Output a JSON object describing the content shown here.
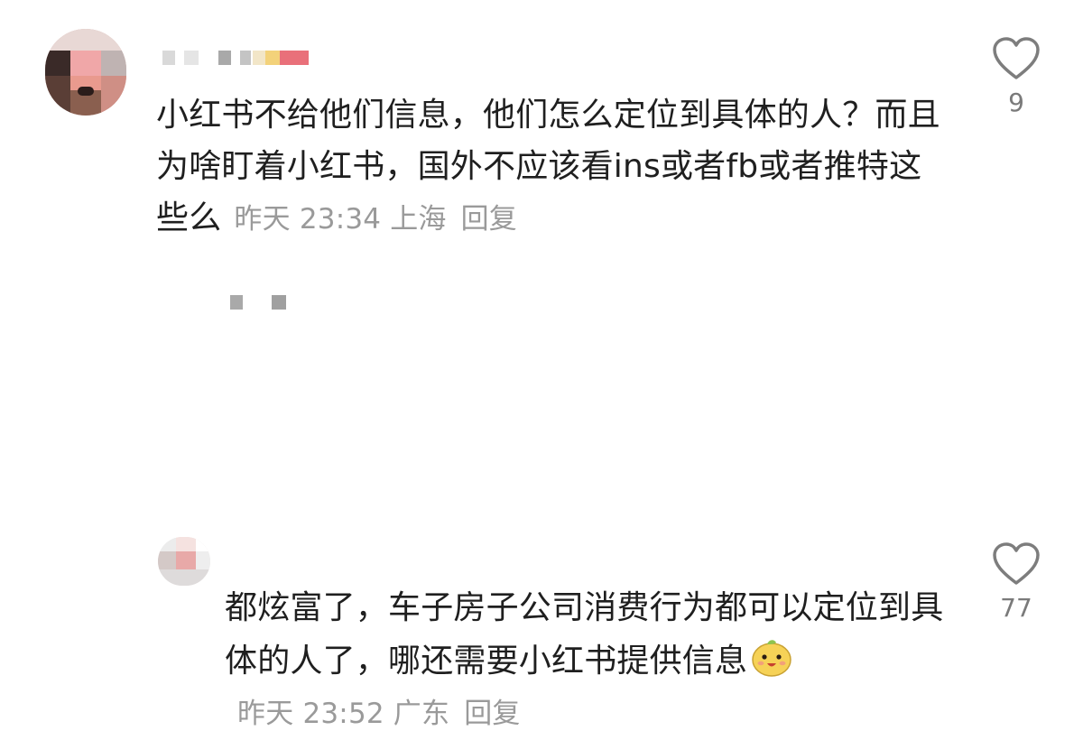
{
  "comments": [
    {
      "text": "小红书不给他们信息，他们怎么定位到具体的人？而且为啥盯着小红书，国外不应该看ins或者fb或者推特这些么",
      "time": "昨天 23:34",
      "location": "上海",
      "reply_label": "回复",
      "likes": "9"
    },
    {
      "text": "都炫富了，车子房子公司消费行为都可以定位到具体的人了，哪还需要小红书提供信息",
      "emoji_icon": "smiling-mascot-emoji",
      "time": "昨天 23:52",
      "location": "广东",
      "reply_label": "回复",
      "likes": "77"
    }
  ],
  "icons": {
    "like": "heart-outline-icon"
  },
  "colors": {
    "text": "#1f1f1f",
    "meta": "#9a9a9a",
    "like_count": "#7a7a7a"
  }
}
